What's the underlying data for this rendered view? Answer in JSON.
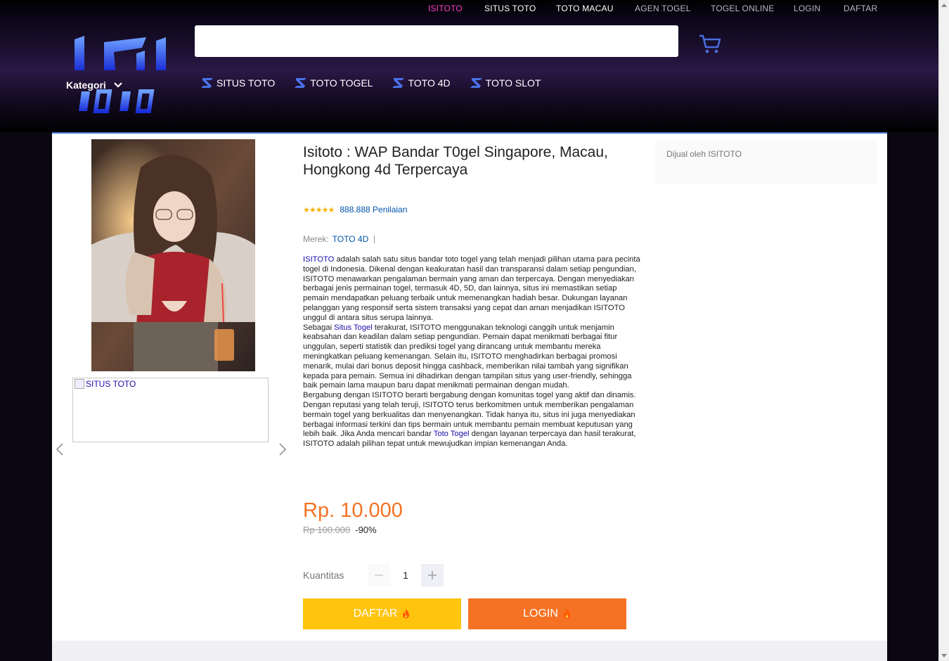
{
  "topnav": {
    "items": [
      "ISITOTO",
      "SITUS TOTO",
      "TOTO MACAU",
      "AGEN TOGEL",
      "TOGEL ONLINE",
      "LOGIN",
      "DAFTAR"
    ]
  },
  "header": {
    "search_placeholder": "",
    "kategori_label": "Kategori",
    "categories": [
      "SITUS TOTO",
      "TOTO TOGEL",
      "TOTO 4D",
      "TOTO SLOT"
    ]
  },
  "gallery": {
    "thumb_alt": "SITUS TOTO"
  },
  "product": {
    "title": "Isitoto : WAP Bandar T0gel Singapore, Macau, Hongkong 4d Terpercaya",
    "stars": 5,
    "stars_text": "★★★★★",
    "rating_count": "888.888 Penilaian",
    "brand_label": "Merek:",
    "brand_value": "TOTO 4D",
    "desc": {
      "p1_link": "ISITOTO",
      "p1": " adalah salah satu situs bandar toto togel yang telah menjadi pilihan utama para pecinta togel di Indonesia. Dikenal dengan keakuratan hasil dan transparansi dalam setiap pengundian, ISITOTO menawarkan pengalaman bermain yang aman dan terpercaya. Dengan menyediakan berbagai jenis permainan togel, termasuk 4D, 5D, dan lainnya, situs ini memastikan setiap pemain mendapatkan peluang terbaik untuk memenangkan hadiah besar. Dukungan layanan pelanggan yang responsif serta sistem transaksi yang cepat dan aman menjadikan ISITOTO unggul di antara situs serupa lainnya.",
      "p2_pre": "Sebagai ",
      "p2_link": "Situs Togel",
      "p2": " terakurat, ISITOTO menggunakan teknologi canggih untuk menjamin keabsahan dan keadilan dalam setiap pengundian. Pemain dapat menikmati berbagai fitur unggulan, seperti statistik dan prediksi togel yang dirancang untuk membantu mereka meningkatkan peluang kemenangan. Selain itu, ISITOTO menghadirkan berbagai promosi menarik, mulai dari bonus deposit hingga cashback, memberikan nilai tambah yang signifikan kepada para pemain. Semua ini dihadirkan dengan tampilan situs yang user-friendly, sehingga baik pemain lama maupun baru dapat menikmati permainan dengan mudah.",
      "p3": "Bergabung dengan ISITOTO berarti bergabung dengan komunitas togel yang aktif dan dinamis. Dengan reputasi yang telah teruji, ISITOTO terus berkomitmen untuk memberikan pengalaman bermain togel yang berkualitas dan menyenangkan. Tidak hanya itu, situs ini juga menyediakan berbagai informasi terkini dan tips bermain untuk membantu pemain membuat keputusan yang lebih baik. Jika Anda mencari bandar ",
      "p3_link": "Toto Togel",
      "p3_post": " dengan layanan terpercaya dan hasil terakurat, ISITOTO adalah pilihan tepat untuk mewujudkan impian kemenangan Anda."
    },
    "price": "Rp. 10.000",
    "original_price": "Rp 100.000",
    "discount": "-90%",
    "quantity_label": "Kuantitas",
    "quantity": "1",
    "daftar_label": "DAFTAR",
    "login_label": "LOGIN"
  },
  "seller": {
    "label": "Dijual oleh ISITOTO"
  },
  "colors": {
    "accent_pink": "#ff3fcc",
    "price_orange": "#f57224",
    "daftar_yellow": "#ffc40d",
    "link_blue": "#0055aa"
  }
}
